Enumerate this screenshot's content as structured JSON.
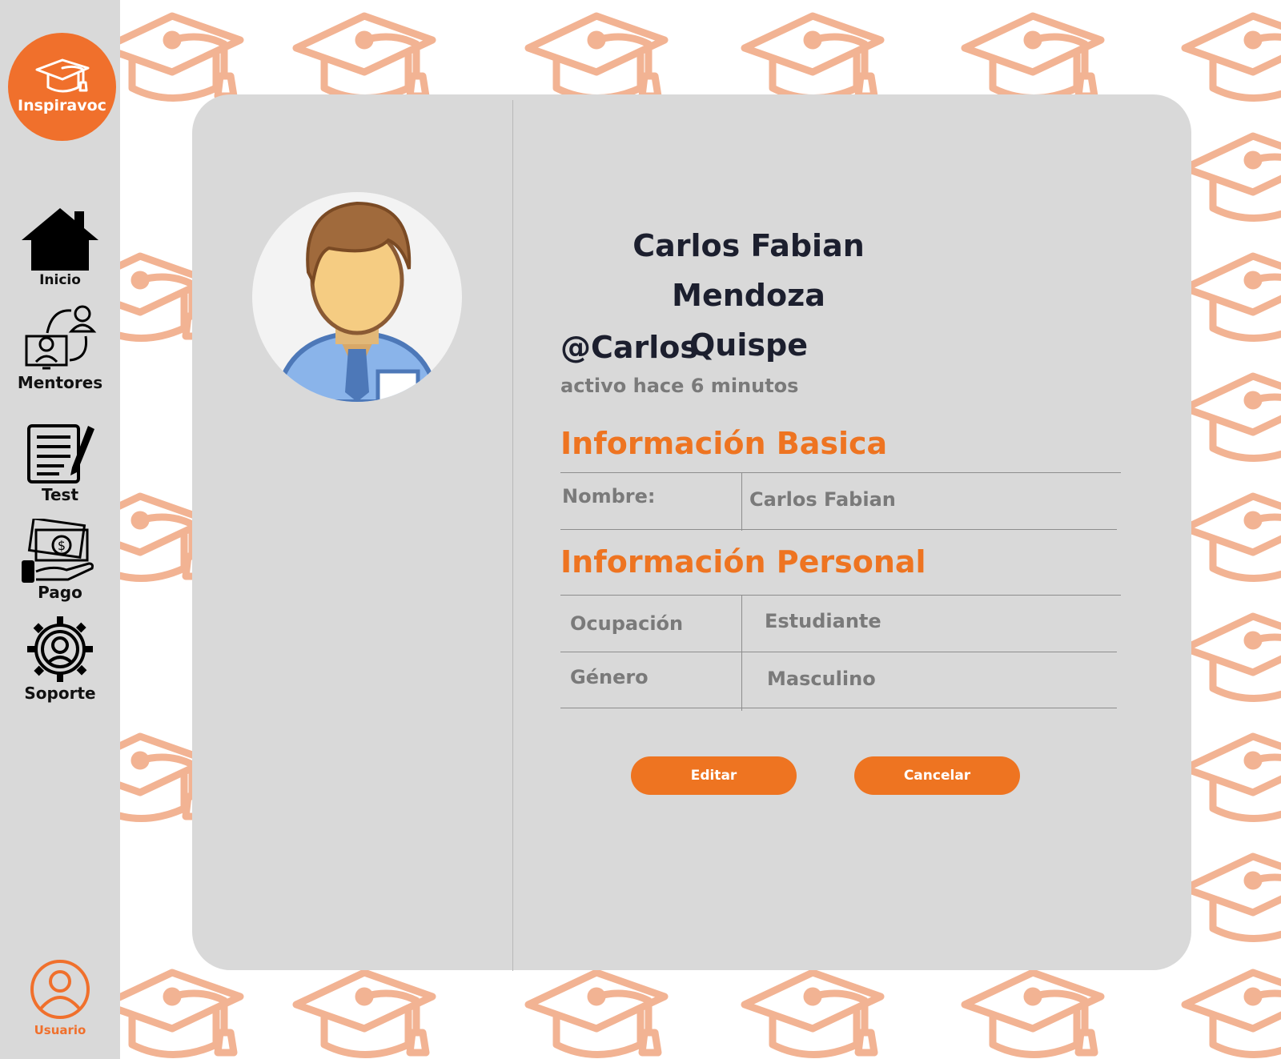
{
  "app": {
    "logo_text": "Inspiravoc",
    "accent": "#ee7421"
  },
  "sidebar": {
    "items": [
      {
        "label": "Inicio",
        "icon": "home-icon"
      },
      {
        "label": "Mentores",
        "icon": "mentors-icon"
      },
      {
        "label": "Test",
        "icon": "test-icon"
      },
      {
        "label": "Pago",
        "icon": "payment-icon"
      },
      {
        "label": "Soporte",
        "icon": "support-icon"
      }
    ],
    "user": {
      "label": "Usuario",
      "icon": "user-icon"
    }
  },
  "profile": {
    "name_line1": "Carlos Fabian Mendoza",
    "name_line2": "Quispe",
    "handle": "@Carlos",
    "status": "activo hace 6  minutos",
    "avatar_icon": "avatar-icon"
  },
  "basic_info": {
    "title": "Información Basica",
    "rows": [
      {
        "label": "Nombre:",
        "value": "Carlos Fabian"
      }
    ]
  },
  "personal_info": {
    "title": "Información Personal",
    "rows": [
      {
        "label": "Ocupación",
        "value": "Estudiante"
      },
      {
        "label": "Género",
        "value": "Masculino"
      }
    ]
  },
  "actions": {
    "edit_label": "Editar",
    "cancel_label": "Cancelar"
  }
}
